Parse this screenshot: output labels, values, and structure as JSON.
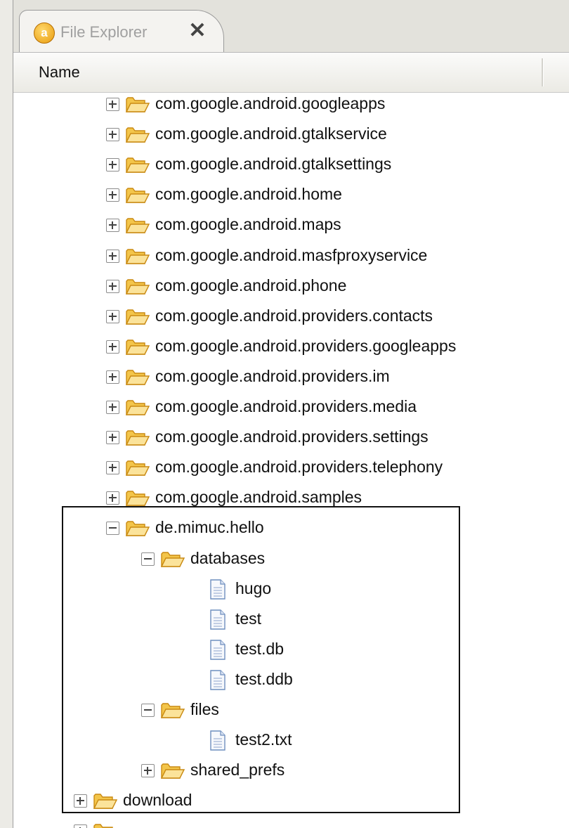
{
  "window": {
    "tab_title": "File Explorer",
    "tab_icon": "ddms-icon",
    "close_glyph": "✕",
    "column_name": "Name"
  },
  "tree": [
    {
      "label": "com.google.android.googleapps",
      "type": "folder",
      "level": 2,
      "state": "collapsed"
    },
    {
      "label": "com.google.android.gtalkservice",
      "type": "folder",
      "level": 2,
      "state": "collapsed"
    },
    {
      "label": "com.google.android.gtalksettings",
      "type": "folder",
      "level": 2,
      "state": "collapsed"
    },
    {
      "label": "com.google.android.home",
      "type": "folder",
      "level": 2,
      "state": "collapsed"
    },
    {
      "label": "com.google.android.maps",
      "type": "folder",
      "level": 2,
      "state": "collapsed"
    },
    {
      "label": "com.google.android.masfproxyservice",
      "type": "folder",
      "level": 2,
      "state": "collapsed"
    },
    {
      "label": "com.google.android.phone",
      "type": "folder",
      "level": 2,
      "state": "collapsed"
    },
    {
      "label": "com.google.android.providers.contacts",
      "type": "folder",
      "level": 2,
      "state": "collapsed"
    },
    {
      "label": "com.google.android.providers.googleapps",
      "type": "folder",
      "level": 2,
      "state": "collapsed"
    },
    {
      "label": "com.google.android.providers.im",
      "type": "folder",
      "level": 2,
      "state": "collapsed"
    },
    {
      "label": "com.google.android.providers.media",
      "type": "folder",
      "level": 2,
      "state": "collapsed"
    },
    {
      "label": "com.google.android.providers.settings",
      "type": "folder",
      "level": 2,
      "state": "collapsed"
    },
    {
      "label": "com.google.android.providers.telephony",
      "type": "folder",
      "level": 2,
      "state": "collapsed"
    },
    {
      "label": "com.google.android.samples",
      "type": "folder",
      "level": 2,
      "state": "collapsed"
    },
    {
      "label": "de.mimuc.hello",
      "type": "folder",
      "level": 2,
      "state": "expanded"
    },
    {
      "label": "databases",
      "type": "folder",
      "level": 3,
      "state": "expanded"
    },
    {
      "label": "hugo",
      "type": "file",
      "level": 4
    },
    {
      "label": "test",
      "type": "file",
      "level": 4
    },
    {
      "label": "test.db",
      "type": "file",
      "level": 4
    },
    {
      "label": "test.ddb",
      "type": "file",
      "level": 4
    },
    {
      "label": "files",
      "type": "folder",
      "level": 3,
      "state": "expanded"
    },
    {
      "label": "test2.txt",
      "type": "file",
      "level": 4
    },
    {
      "label": "shared_prefs",
      "type": "folder",
      "level": 3,
      "state": "collapsed"
    },
    {
      "label": "download",
      "type": "folder",
      "level": 1,
      "state": "collapsed"
    },
    {
      "label": "",
      "type": "folder",
      "level": 1,
      "state": "collapsed"
    }
  ],
  "colors": {
    "folder": "#f3c54a",
    "folder_outline": "#c98a12",
    "file_outline": "#6f8fbf"
  }
}
